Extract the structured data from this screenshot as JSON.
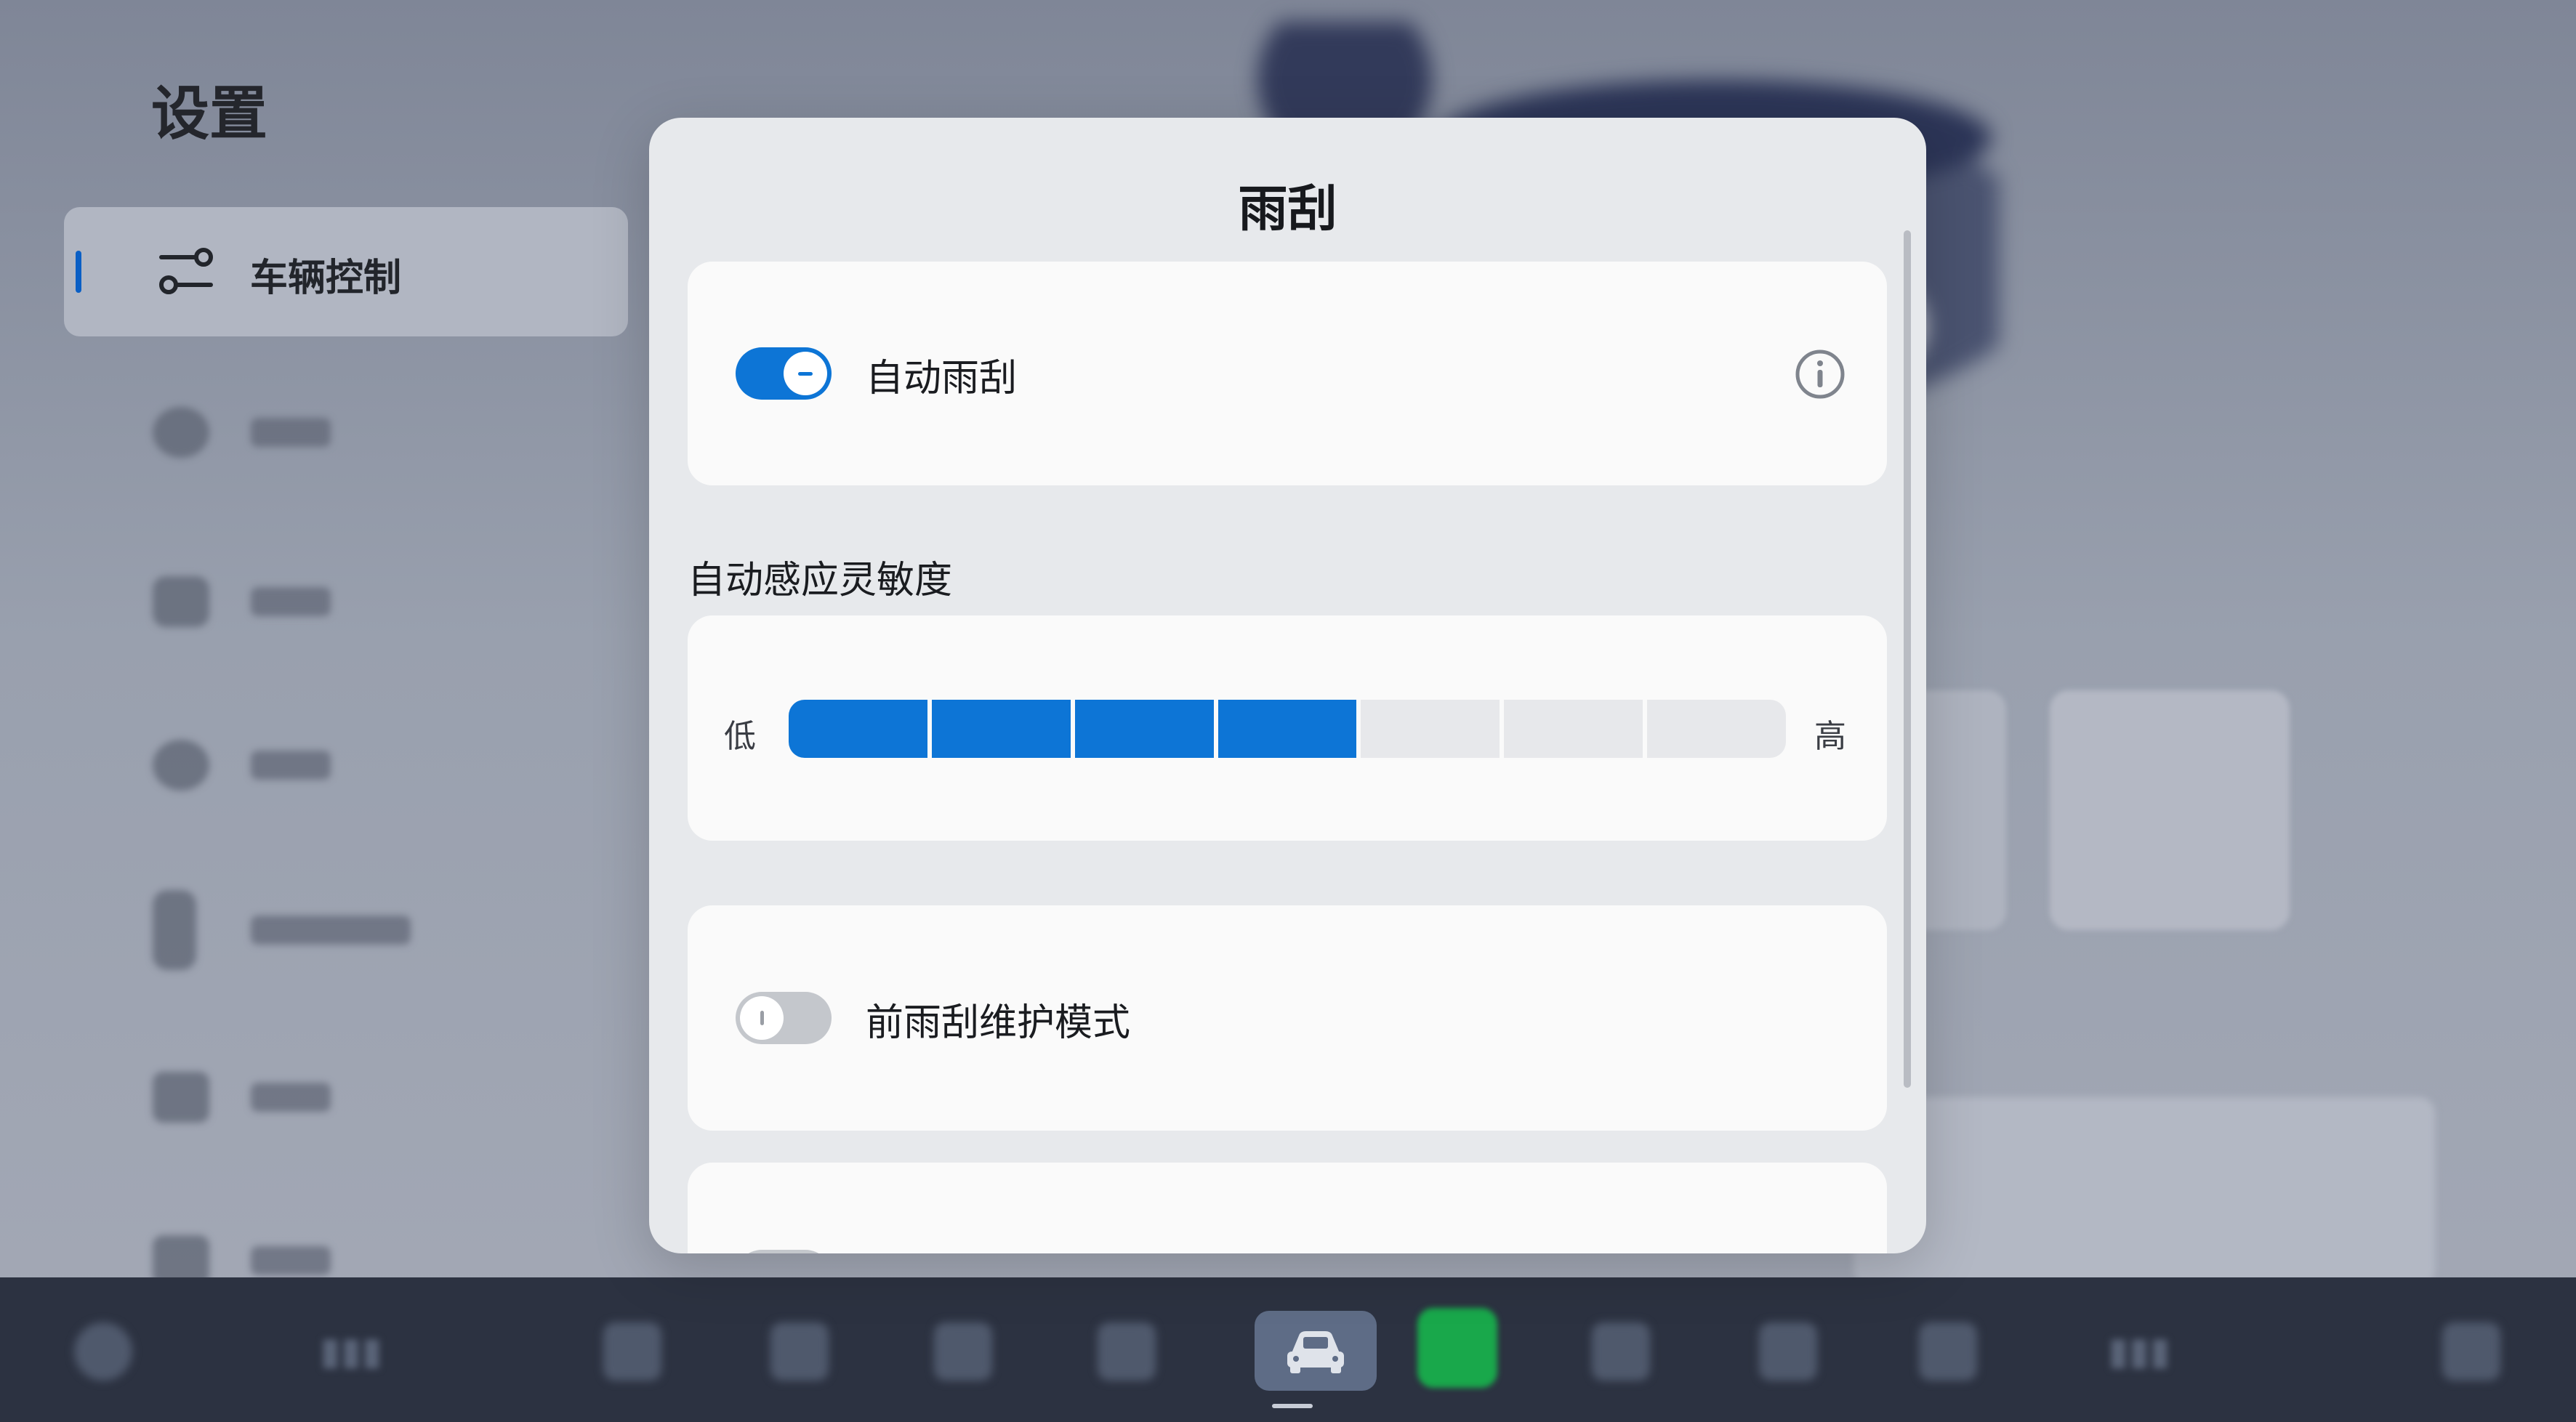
{
  "settings": {
    "title": "设置",
    "selected_item": {
      "label": "车辆控制",
      "icon": "sliders-icon"
    }
  },
  "modal": {
    "title": "雨刮",
    "auto_wiper": {
      "label": "自动雨刮",
      "enabled": true,
      "info_icon": "info-icon"
    },
    "sensitivity": {
      "label": "自动感应灵敏度",
      "low_label": "低",
      "high_label": "高",
      "level": 4,
      "max_level": 7
    },
    "maintenance_mode": {
      "label": "前雨刮维护模式",
      "enabled": false
    }
  },
  "taskbar": {
    "active_item": "car-icon"
  },
  "colors": {
    "accent": "#0d75d6",
    "modal_bg": "#e7e9ec",
    "card_bg": "#fafafa",
    "taskbar_bg": "#2c3241"
  }
}
